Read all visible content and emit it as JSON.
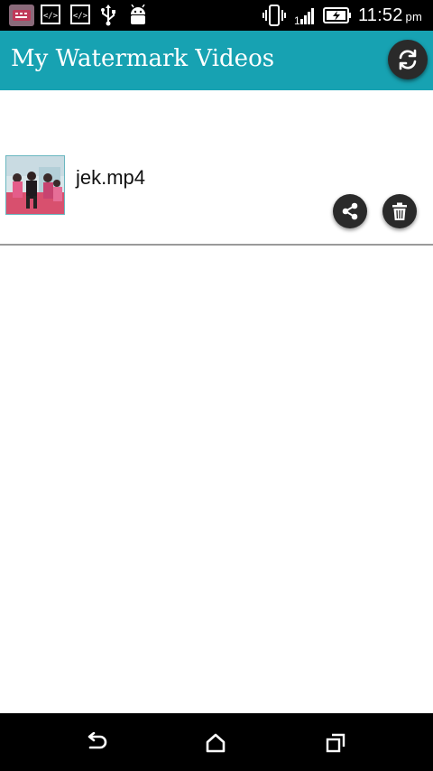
{
  "status_bar": {
    "time": "11:52",
    "ampm": "pm",
    "icons": [
      "app-notification-icon",
      "code-icon",
      "code-icon",
      "usb-icon",
      "android-debug-icon",
      "vibrate-icon",
      "signal-icon",
      "battery-charging-icon"
    ]
  },
  "app_bar": {
    "title": "My Watermark Videos",
    "color": "#17a2b2",
    "refresh_icon": "refresh-icon"
  },
  "videos": [
    {
      "file_name": "jek.mp4",
      "share_icon": "share-icon",
      "delete_icon": "trash-icon"
    }
  ],
  "nav_bar": {
    "icons": [
      "back-icon",
      "home-icon",
      "recent-apps-icon"
    ]
  }
}
